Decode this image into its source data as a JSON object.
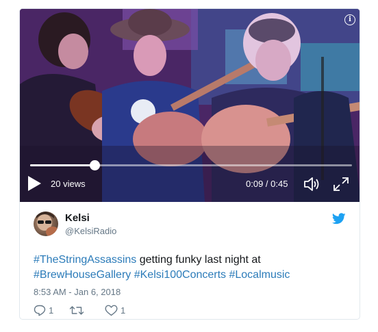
{
  "video": {
    "views": "20 views",
    "time": "0:09 / 0:45",
    "progress_fraction": 0.2
  },
  "tweet": {
    "name": "Kelsi",
    "handle": "@KelsiRadio",
    "text_parts": [
      {
        "text": "#TheStringAssassins",
        "hashtag": true
      },
      {
        "text": " getting funky last night at ",
        "hashtag": false
      },
      {
        "text": "#BrewHouseGallery",
        "hashtag": true
      },
      {
        "text": " ",
        "hashtag": false
      },
      {
        "text": "#Kelsi100Concerts",
        "hashtag": true
      },
      {
        "text": " ",
        "hashtag": false
      },
      {
        "text": "#Localmusic",
        "hashtag": true
      }
    ],
    "timestamp": "8:53 AM - Jan 6, 2018",
    "reply_count": "1",
    "retweet_count": "",
    "like_count": "1"
  },
  "colors": {
    "hashtag": "#2b7bb9",
    "twitter_blue": "#1da1f2",
    "muted": "#657786"
  },
  "icons": [
    "info-icon",
    "play-icon",
    "volume-icon",
    "fullscreen-icon",
    "twitter-bird-icon",
    "reply-icon",
    "retweet-icon",
    "like-icon"
  ]
}
